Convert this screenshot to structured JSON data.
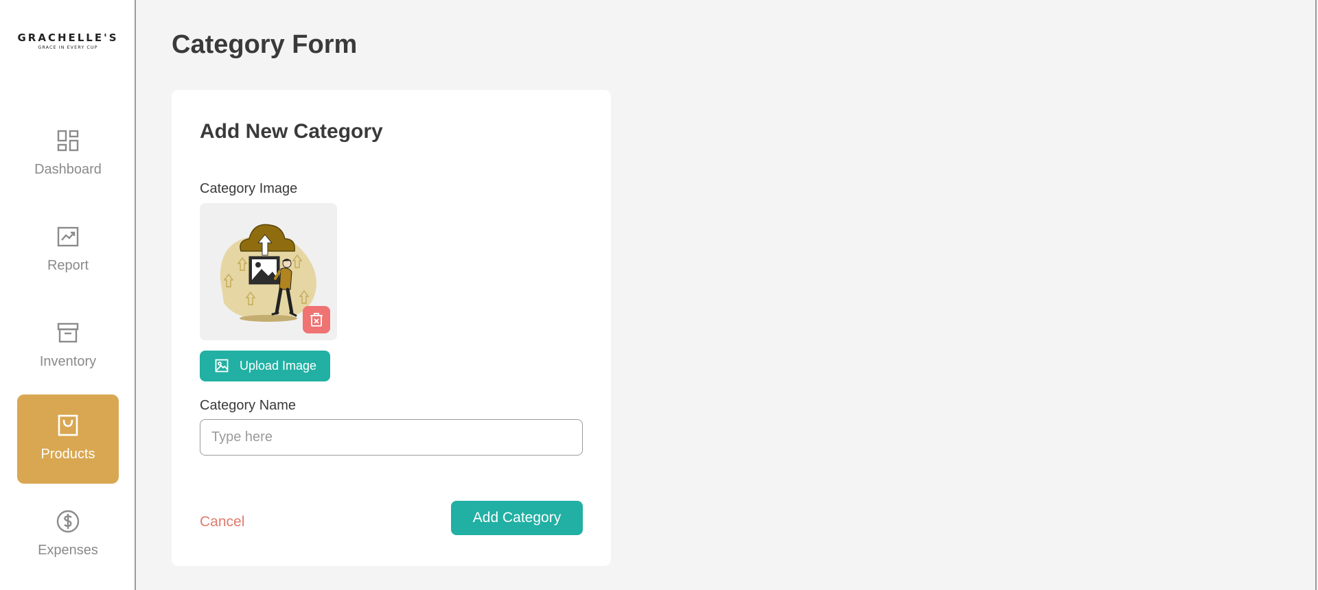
{
  "brand": {
    "name": "GRACHELLE'S",
    "tagline": "GRACE IN EVERY CUP"
  },
  "sidebar": {
    "items": [
      {
        "label": "Dashboard",
        "icon": "dashboard-icon",
        "active": false
      },
      {
        "label": "Report",
        "icon": "report-chart-icon",
        "active": false
      },
      {
        "label": "Inventory",
        "icon": "archive-box-icon",
        "active": false
      },
      {
        "label": "Products",
        "icon": "shopping-bag-icon",
        "active": true
      },
      {
        "label": "Expenses",
        "icon": "dollar-circle-icon",
        "active": false
      }
    ]
  },
  "page": {
    "title": "Category Form"
  },
  "form": {
    "title": "Add New Category",
    "image_label": "Category Image",
    "image_icon": "upload-illustration",
    "delete_icon": "trash-icon",
    "upload_label": "Upload Image",
    "upload_icon": "image-icon",
    "name_label": "Category Name",
    "name_value": "",
    "name_placeholder": "Type here",
    "cancel_label": "Cancel",
    "submit_label": "Add Category"
  },
  "colors": {
    "accent_teal": "#21b0a3",
    "active_nav": "#d9a752",
    "danger": "#ef7373",
    "cancel_text": "#e07a6d"
  }
}
